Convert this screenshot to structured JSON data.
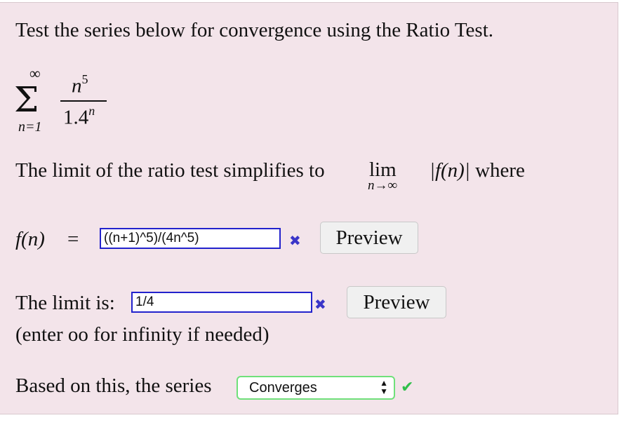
{
  "prompt": "Test the series below for convergence using the Ratio Test.",
  "series": {
    "sum_top": "∞",
    "sum_symbol": "Σ",
    "sum_bottom": "n=1",
    "numerator_base": "n",
    "numerator_exp": "5",
    "denominator_base": "1.4",
    "denominator_exp": "n"
  },
  "limit_sentence": {
    "lead": "The limit of the ratio test simplifies to",
    "lim": "lim",
    "lim_sub": "n→∞",
    "expr": "|f(n)|",
    "tail": "where"
  },
  "fn_row": {
    "label": "f(n)",
    "equals": "=",
    "input_value": "((n+1)^5)/(4n^5)",
    "status_icon": "x-mark-icon",
    "preview_label": "Preview"
  },
  "limit_row": {
    "label": "The limit is:",
    "input_value": "1/4",
    "status_icon": "x-mark-icon",
    "preview_label": "Preview",
    "hint": "(enter oo for infinity if needed)"
  },
  "series_row": {
    "label": "Based on this, the series",
    "selected": "Converges",
    "status_icon": "checkmark-icon"
  },
  "colors": {
    "panel_bg": "#f3e4ea",
    "input_border": "#2222cc",
    "wrong_mark": "#3a35c8",
    "correct_border": "#6fe07a",
    "correct_mark": "#2fbf4a"
  }
}
